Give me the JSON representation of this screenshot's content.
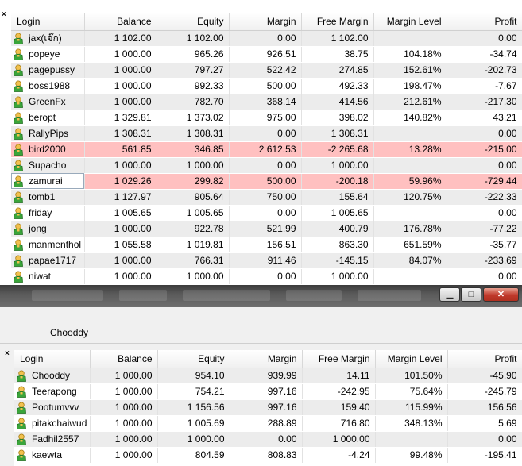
{
  "columns": [
    "Login",
    "Balance",
    "Equity",
    "Margin",
    "Free Margin",
    "Margin Level",
    "Profit"
  ],
  "top_rows": [
    {
      "login": "jax(เจ๊ก)",
      "balance": "1 102.00",
      "equity": "1 102.00",
      "margin": "0.00",
      "free_margin": "1 102.00",
      "margin_level": "",
      "profit": "0.00",
      "style": "even"
    },
    {
      "login": "popeye",
      "balance": "1 000.00",
      "equity": "965.26",
      "margin": "926.51",
      "free_margin": "38.75",
      "margin_level": "104.18%",
      "profit": "-34.74",
      "style": "odd"
    },
    {
      "login": "pagepussy",
      "balance": "1 000.00",
      "equity": "797.27",
      "margin": "522.42",
      "free_margin": "274.85",
      "margin_level": "152.61%",
      "profit": "-202.73",
      "style": "even"
    },
    {
      "login": "boss1988",
      "balance": "1 000.00",
      "equity": "992.33",
      "margin": "500.00",
      "free_margin": "492.33",
      "margin_level": "198.47%",
      "profit": "-7.67",
      "style": "odd"
    },
    {
      "login": "GreenFx",
      "balance": "1 000.00",
      "equity": "782.70",
      "margin": "368.14",
      "free_margin": "414.56",
      "margin_level": "212.61%",
      "profit": "-217.30",
      "style": "even"
    },
    {
      "login": "beropt",
      "balance": "1 329.81",
      "equity": "1 373.02",
      "margin": "975.00",
      "free_margin": "398.02",
      "margin_level": "140.82%",
      "profit": "43.21",
      "style": "odd"
    },
    {
      "login": "RallyPips",
      "balance": "1 308.31",
      "equity": "1 308.31",
      "margin": "0.00",
      "free_margin": "1 308.31",
      "margin_level": "",
      "profit": "0.00",
      "style": "even"
    },
    {
      "login": "bird2000",
      "balance": "561.85",
      "equity": "346.85",
      "margin": "2 612.53",
      "free_margin": "-2 265.68",
      "margin_level": "13.28%",
      "profit": "-215.00",
      "style": "warn"
    },
    {
      "login": "Supacho",
      "balance": "1 000.00",
      "equity": "1 000.00",
      "margin": "0.00",
      "free_margin": "1 000.00",
      "margin_level": "",
      "profit": "0.00",
      "style": "even"
    },
    {
      "login": "zamurai",
      "balance": "1 029.26",
      "equity": "299.82",
      "margin": "500.00",
      "free_margin": "-200.18",
      "margin_level": "59.96%",
      "profit": "-729.44",
      "style": "warn sel"
    },
    {
      "login": "tomb1",
      "balance": "1 127.97",
      "equity": "905.64",
      "margin": "750.00",
      "free_margin": "155.64",
      "margin_level": "120.75%",
      "profit": "-222.33",
      "style": "even"
    },
    {
      "login": "friday",
      "balance": "1 005.65",
      "equity": "1 005.65",
      "margin": "0.00",
      "free_margin": "1 005.65",
      "margin_level": "",
      "profit": "0.00",
      "style": "odd"
    },
    {
      "login": "jong",
      "balance": "1 000.00",
      "equity": "922.78",
      "margin": "521.99",
      "free_margin": "400.79",
      "margin_level": "176.78%",
      "profit": "-77.22",
      "style": "even"
    },
    {
      "login": "manmenthol",
      "balance": "1 055.58",
      "equity": "1 019.81",
      "margin": "156.51",
      "free_margin": "863.30",
      "margin_level": "651.59%",
      "profit": "-35.77",
      "style": "odd"
    },
    {
      "login": "papae1717",
      "balance": "1 000.00",
      "equity": "766.31",
      "margin": "911.46",
      "free_margin": "-145.15",
      "margin_level": "84.07%",
      "profit": "-233.69",
      "style": "even"
    },
    {
      "login": "niwat",
      "balance": "1 000.00",
      "equity": "1 000.00",
      "margin": "0.00",
      "free_margin": "1 000.00",
      "margin_level": "",
      "profit": "0.00",
      "style": "odd"
    }
  ],
  "window": {
    "label": "Chooddy",
    "minimize": "▁",
    "maximize": "□",
    "close": "✕"
  },
  "bottom_rows": [
    {
      "login": "Chooddy",
      "balance": "1 000.00",
      "equity": "954.10",
      "margin": "939.99",
      "free_margin": "14.11",
      "margin_level": "101.50%",
      "profit": "-45.90",
      "style": "even"
    },
    {
      "login": "Teerapong",
      "balance": "1 000.00",
      "equity": "754.21",
      "margin": "997.16",
      "free_margin": "-242.95",
      "margin_level": "75.64%",
      "profit": "-245.79",
      "style": "odd"
    },
    {
      "login": "Pootumvvv",
      "balance": "1 000.00",
      "equity": "1 156.56",
      "margin": "997.16",
      "free_margin": "159.40",
      "margin_level": "115.99%",
      "profit": "156.56",
      "style": "even"
    },
    {
      "login": "pitakchaiwud",
      "balance": "1 000.00",
      "equity": "1 005.69",
      "margin": "288.89",
      "free_margin": "716.80",
      "margin_level": "348.13%",
      "profit": "5.69",
      "style": "odd"
    },
    {
      "login": "Fadhil2557",
      "balance": "1 000.00",
      "equity": "1 000.00",
      "margin": "0.00",
      "free_margin": "1 000.00",
      "margin_level": "",
      "profit": "0.00",
      "style": "even"
    },
    {
      "login": "kaewta",
      "balance": "1 000.00",
      "equity": "804.59",
      "margin": "808.83",
      "free_margin": "-4.24",
      "margin_level": "99.48%",
      "profit": "-195.41",
      "style": "odd"
    }
  ],
  "close_glyph": "×",
  "icon": "user-icon",
  "colors": {
    "warn_row": "#ffc0c0",
    "even_row": "#ececec",
    "odd_row": "#ffffff",
    "title_bar": "#5a5a5a"
  }
}
